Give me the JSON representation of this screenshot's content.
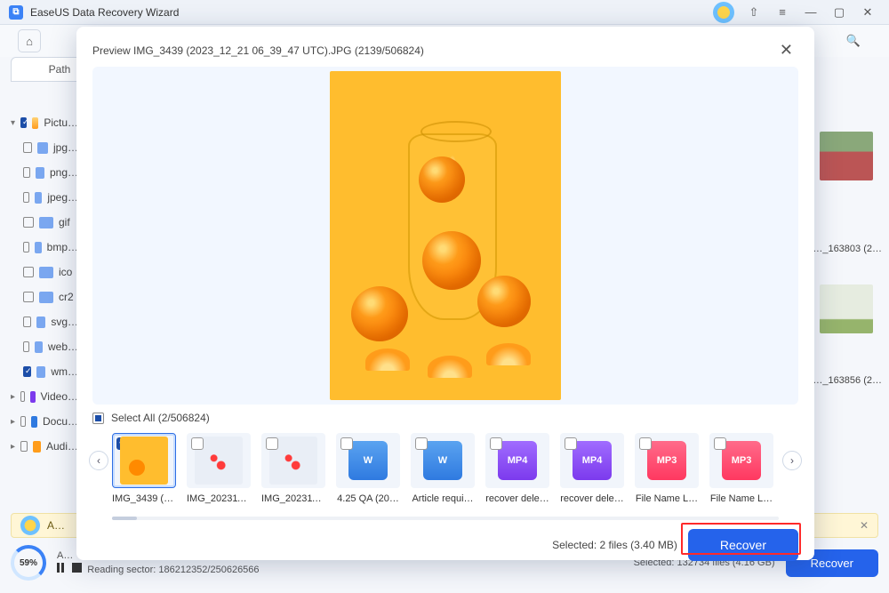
{
  "app": {
    "title": "EaseUS Data Recovery Wizard"
  },
  "main": {
    "path_tab": "Path",
    "sidebar": {
      "root": "Pictu…",
      "items": [
        "jpg…",
        "png…",
        "jpeg…",
        "gif",
        "bmp…",
        "ico",
        "cr2",
        "svg…",
        "web…",
        "wm…"
      ],
      "other_roots": [
        "Video…",
        "Docu…",
        "Audi…"
      ]
    },
    "bg_thumbs": [
      "…_163803 (2…",
      "…_163856 (2…"
    ],
    "notice": "A…",
    "status": {
      "percent": "59%",
      "reading_label": "Reading sector:",
      "reading_value": "186212352/250626566",
      "top_label": "A…",
      "selected_bg": "Selected: 132734 files (4.16 GB)",
      "recover_bg": "Recover"
    }
  },
  "modal": {
    "title": "Preview IMG_3439 (2023_12_21 06_39_47 UTC).JPG (2139/506824)",
    "select_all": "Select All (2/506824)",
    "thumbs": [
      {
        "label": "IMG_3439 (2…",
        "kind": "photo-main",
        "selected": true
      },
      {
        "label": "IMG_202311…",
        "kind": "photo-mini",
        "selected": false
      },
      {
        "label": "IMG_202311…",
        "kind": "photo-mini",
        "selected": false
      },
      {
        "label": "4.25 QA (20…",
        "kind": "doc-blue",
        "badge": "W",
        "selected": false
      },
      {
        "label": "Article requi…",
        "kind": "doc-blue",
        "badge": "W",
        "selected": false
      },
      {
        "label": "recover dele…",
        "kind": "mp4",
        "badge": "MP4",
        "selected": false
      },
      {
        "label": "recover dele…",
        "kind": "mp4",
        "badge": "MP4",
        "selected": false
      },
      {
        "label": "File Name L…",
        "kind": "mp3",
        "badge": "MP3",
        "selected": false
      },
      {
        "label": "File Name L…",
        "kind": "mp3",
        "badge": "MP3",
        "selected": false
      }
    ],
    "selected_text": "Selected: 2 files (3.40 MB)",
    "recover": "Recover"
  }
}
